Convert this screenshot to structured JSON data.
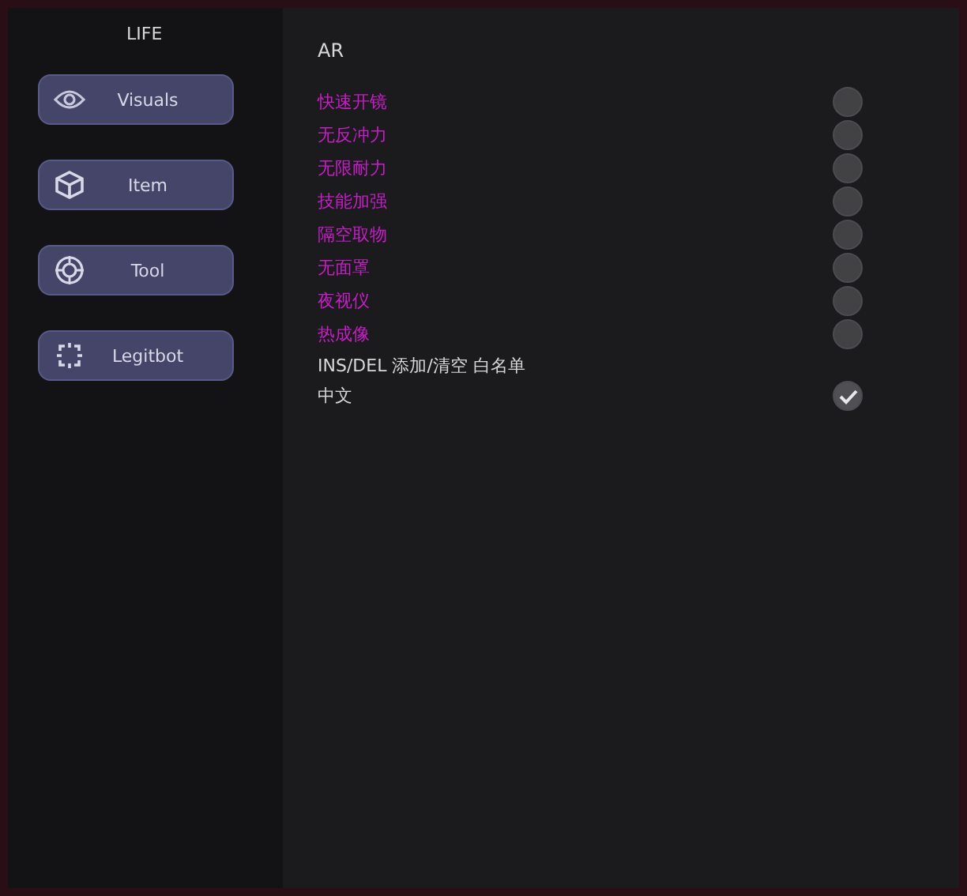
{
  "sidebar": {
    "title": "LIFE",
    "items": [
      {
        "label": "Visuals"
      },
      {
        "label": "Item"
      },
      {
        "label": "Tool"
      },
      {
        "label": "Legitbot"
      }
    ]
  },
  "panel": {
    "title": "AR",
    "rows": [
      {
        "kind": "toggle",
        "label": "快速开镜",
        "color": "#c81ec8",
        "checked": false
      },
      {
        "kind": "toggle",
        "label": "无反冲力",
        "color": "#c81ec8",
        "checked": false
      },
      {
        "kind": "toggle",
        "label": "无限耐力",
        "color": "#c81ec8",
        "checked": false
      },
      {
        "kind": "toggle",
        "label": "技能加强",
        "color": "#c81ec8",
        "checked": false
      },
      {
        "kind": "toggle",
        "label": "隔空取物",
        "color": "#c81ec8",
        "checked": false
      },
      {
        "kind": "toggle",
        "label": "无面罩",
        "color": "#c81ec8",
        "checked": false
      },
      {
        "kind": "toggle",
        "label": "夜视仪",
        "color": "#c81ec8",
        "checked": false
      },
      {
        "kind": "toggle",
        "label": "热成像",
        "color": "#c81ec8",
        "checked": false
      },
      {
        "kind": "note",
        "label": "INS/DEL 添加/清空 白名单",
        "color": "#d8d8d8"
      },
      {
        "kind": "toggle",
        "label": "中文",
        "color": "#d8d8d8",
        "checked": true
      }
    ]
  }
}
